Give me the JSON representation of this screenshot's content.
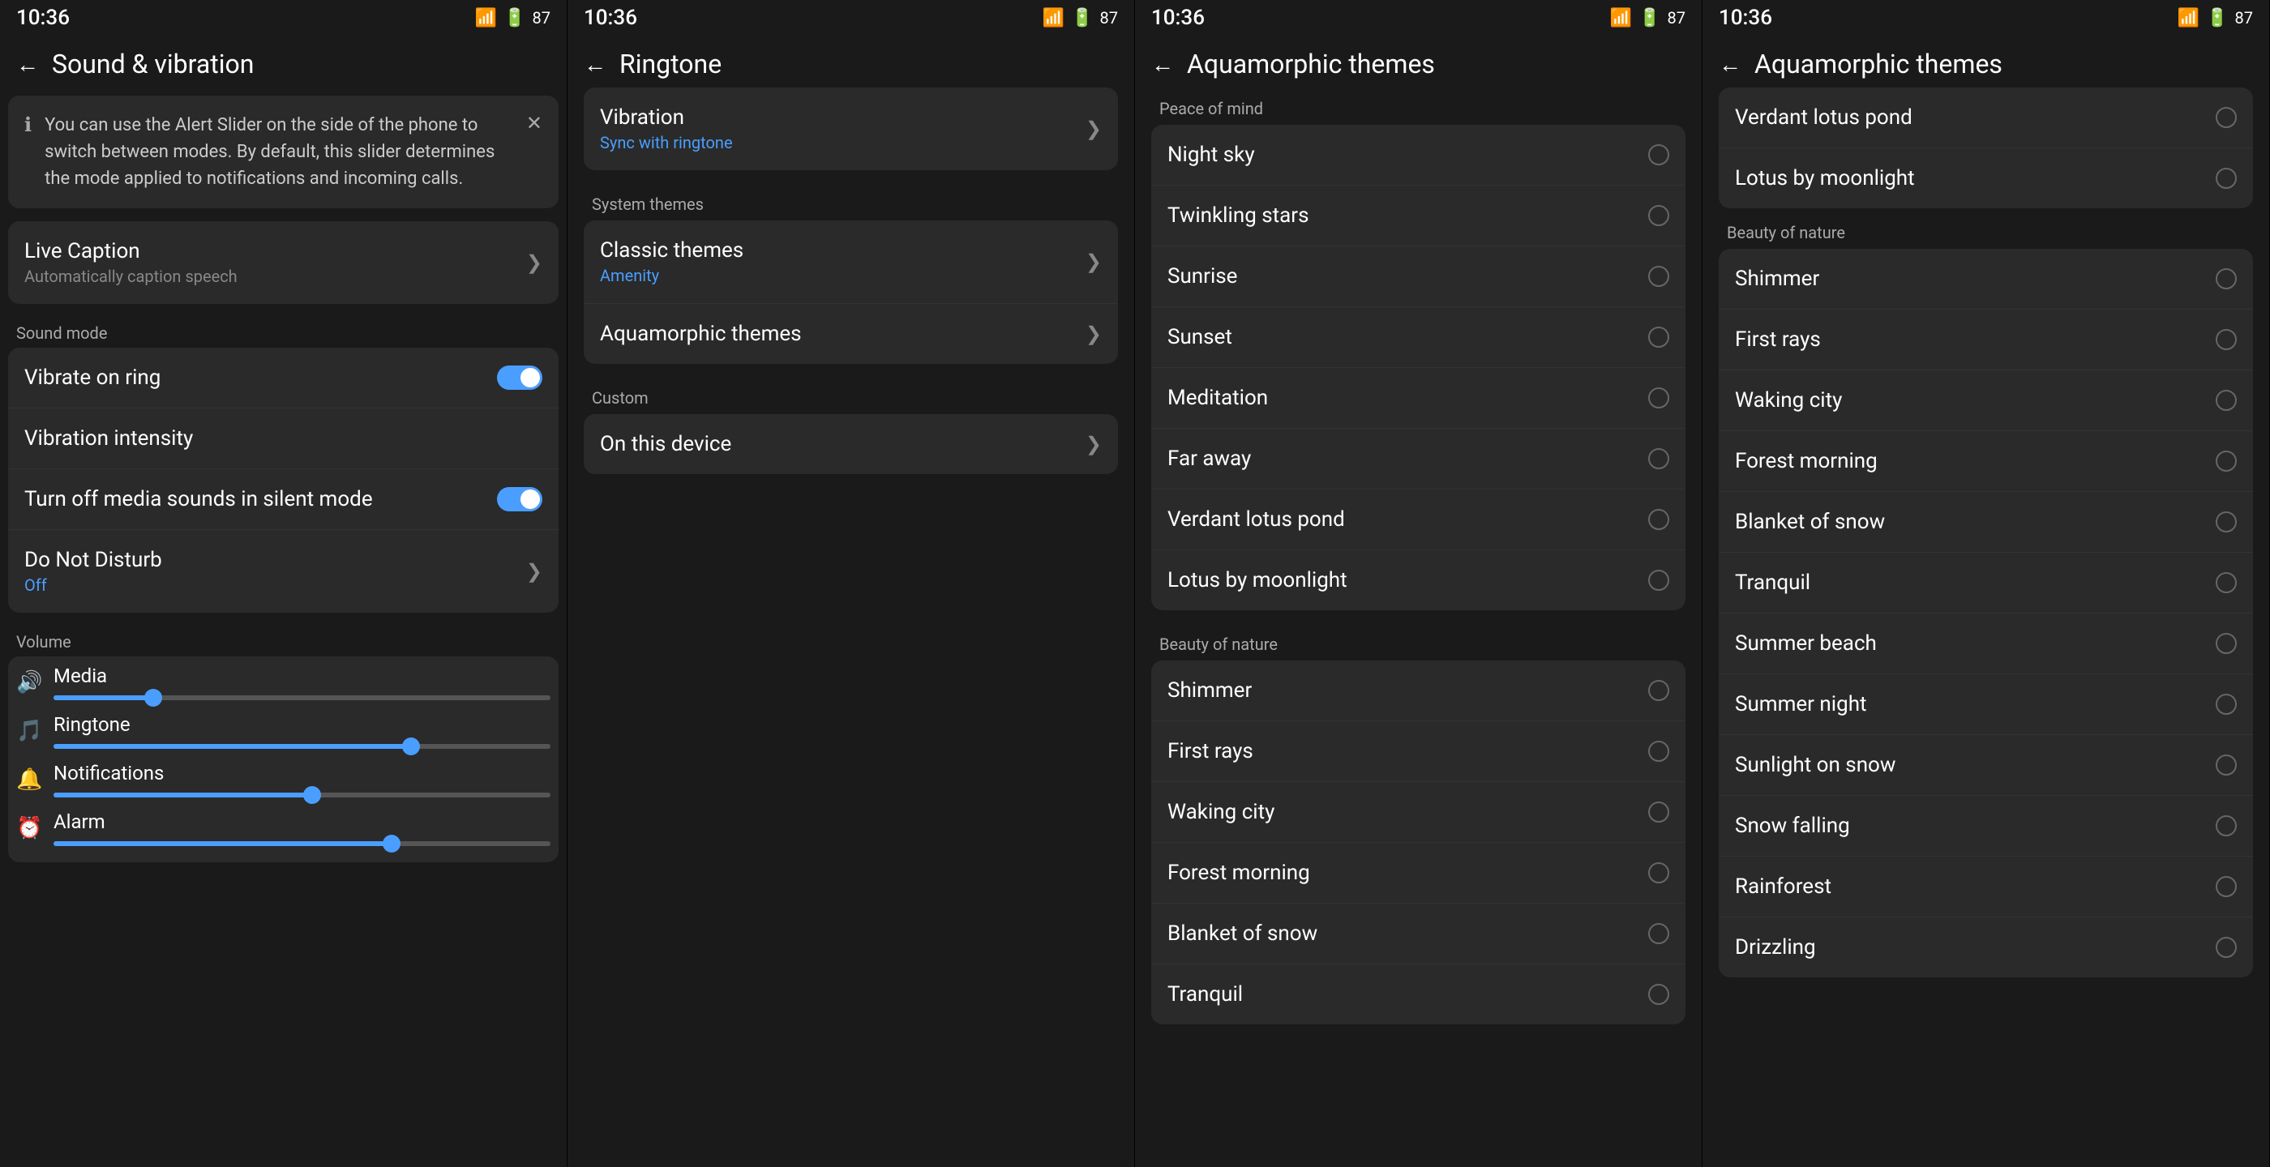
{
  "screens": [
    {
      "id": "sound-vibration",
      "statusTime": "10:36",
      "title": "Sound & vibration",
      "alert": {
        "text": "You can use the Alert Slider on the side of the phone to switch between modes. By default, this slider determines the mode applied to notifications and incoming calls."
      },
      "liveCaption": {
        "title": "Live Caption",
        "subtitle": "Automatically caption speech"
      },
      "soundModeLabel": "Sound mode",
      "rows": [
        {
          "title": "Vibrate on ring",
          "toggle": true,
          "toggleOn": true
        },
        {
          "title": "Vibration intensity",
          "toggle": false
        },
        {
          "title": "Turn off media sounds in silent mode",
          "toggle": true,
          "toggleOn": true
        },
        {
          "title": "Do Not Disturb",
          "sub": "Off",
          "subColor": "blue",
          "arrow": true
        }
      ],
      "volumeLabel": "Volume",
      "sliders": [
        {
          "label": "Media",
          "icon": "🔊",
          "fill": 20
        },
        {
          "label": "Ringtone",
          "icon": "🎵",
          "fill": 72
        },
        {
          "label": "Notifications",
          "icon": "🔔",
          "fill": 52
        },
        {
          "label": "Alarm",
          "icon": "⏰",
          "fill": 68
        }
      ]
    },
    {
      "id": "ringtone",
      "statusTime": "10:36",
      "title": "Ringtone",
      "sections": [
        {
          "label": "",
          "items": [
            {
              "title": "Vibration",
              "sub": "Sync with ringtone",
              "subColor": "blue",
              "arrow": true
            }
          ]
        },
        {
          "label": "System themes",
          "items": [
            {
              "title": "Classic themes",
              "sub": "Amenity",
              "subColor": "blue",
              "arrow": true
            },
            {
              "title": "Aquamorphic themes",
              "sub": "",
              "arrow": true
            }
          ]
        },
        {
          "label": "Custom",
          "items": [
            {
              "title": "On this device",
              "sub": "",
              "arrow": true
            }
          ]
        }
      ]
    },
    {
      "id": "aquamorphic-1",
      "statusTime": "10:36",
      "title": "Aquamorphic themes",
      "sections": [
        {
          "label": "Peace of mind",
          "items": [
            {
              "title": "Night sky",
              "radio": true,
              "selected": false
            },
            {
              "title": "Twinkling stars",
              "radio": true,
              "selected": false
            },
            {
              "title": "Sunrise",
              "radio": true,
              "selected": false
            },
            {
              "title": "Sunset",
              "radio": true,
              "selected": false
            },
            {
              "title": "Meditation",
              "radio": true,
              "selected": false
            },
            {
              "title": "Far away",
              "radio": true,
              "selected": false
            },
            {
              "title": "Verdant lotus pond",
              "radio": true,
              "selected": false
            },
            {
              "title": "Lotus by moonlight",
              "radio": true,
              "selected": false
            }
          ]
        },
        {
          "label": "Beauty of nature",
          "items": [
            {
              "title": "Shimmer",
              "radio": true,
              "selected": false
            },
            {
              "title": "First rays",
              "radio": true,
              "selected": false
            },
            {
              "title": "Waking city",
              "radio": true,
              "selected": false
            },
            {
              "title": "Forest morning",
              "radio": true,
              "selected": false
            },
            {
              "title": "Blanket of snow",
              "radio": true,
              "selected": false
            },
            {
              "title": "Tranquil",
              "radio": true,
              "selected": false
            }
          ]
        }
      ]
    },
    {
      "id": "aquamorphic-2",
      "statusTime": "10:36",
      "title": "Aquamorphic themes",
      "topItems": [
        {
          "title": "Verdant lotus pond",
          "radio": true,
          "selected": false
        },
        {
          "title": "Lotus by moonlight",
          "radio": true,
          "selected": false
        }
      ],
      "sections": [
        {
          "label": "Beauty of nature",
          "items": [
            {
              "title": "Shimmer",
              "radio": true,
              "selected": false
            },
            {
              "title": "First rays",
              "radio": true,
              "selected": false
            },
            {
              "title": "Waking city",
              "radio": true,
              "selected": false
            },
            {
              "title": "Forest morning",
              "radio": true,
              "selected": false
            },
            {
              "title": "Blanket of snow",
              "radio": true,
              "selected": false
            },
            {
              "title": "Tranquil",
              "radio": true,
              "selected": false
            },
            {
              "title": "Summer beach",
              "radio": true,
              "selected": false
            },
            {
              "title": "Summer night",
              "radio": true,
              "selected": false
            },
            {
              "title": "Sunlight on snow",
              "radio": true,
              "selected": false
            },
            {
              "title": "Snow falling",
              "radio": true,
              "selected": false
            },
            {
              "title": "Rainforest",
              "radio": true,
              "selected": false
            },
            {
              "title": "Drizzling",
              "radio": true,
              "selected": false
            }
          ]
        }
      ]
    }
  ]
}
